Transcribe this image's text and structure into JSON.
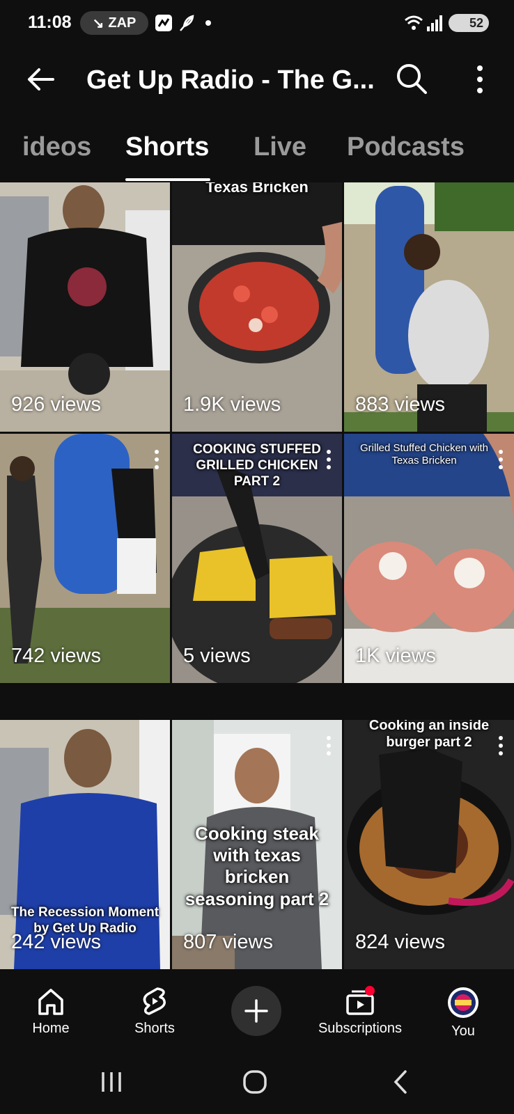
{
  "status_bar": {
    "time": "11:08",
    "carrier_badge": "ZAP",
    "battery": "52"
  },
  "header": {
    "title": "Get Up Radio - The G..."
  },
  "tabs": [
    {
      "label": "ideos"
    },
    {
      "label": "Shorts"
    },
    {
      "label": "Live"
    },
    {
      "label": "Podcasts"
    }
  ],
  "active_tab": "Shorts",
  "shorts": [
    {
      "caption": "Texas Bricken",
      "views": "926 views"
    },
    {
      "caption": "",
      "views": "1.9K views"
    },
    {
      "caption": "",
      "views": "883 views"
    },
    {
      "caption": "",
      "views": "742 views"
    },
    {
      "caption": "COOKING STUFFED GRILLED CHICKEN PART 2",
      "views": "5 views"
    },
    {
      "caption": "Grilled Stuffed Chicken with Texas Bricken",
      "views": "1K views"
    },
    {
      "caption": "The Recession Moment by Get Up Radio",
      "views": "242 views"
    },
    {
      "caption": "Cooking steak with texas bricken seasoning part 2",
      "views": "807 views"
    },
    {
      "caption": "Cooking an inside burger part 2",
      "views": "824 views"
    }
  ],
  "bottom_nav": {
    "home": "Home",
    "shorts": "Shorts",
    "subscriptions": "Subscriptions",
    "you": "You"
  },
  "colors": {
    "background": "#0f0f0f",
    "notification_dot": "#ff0033",
    "inactive_tab": "#9a9a9a"
  }
}
